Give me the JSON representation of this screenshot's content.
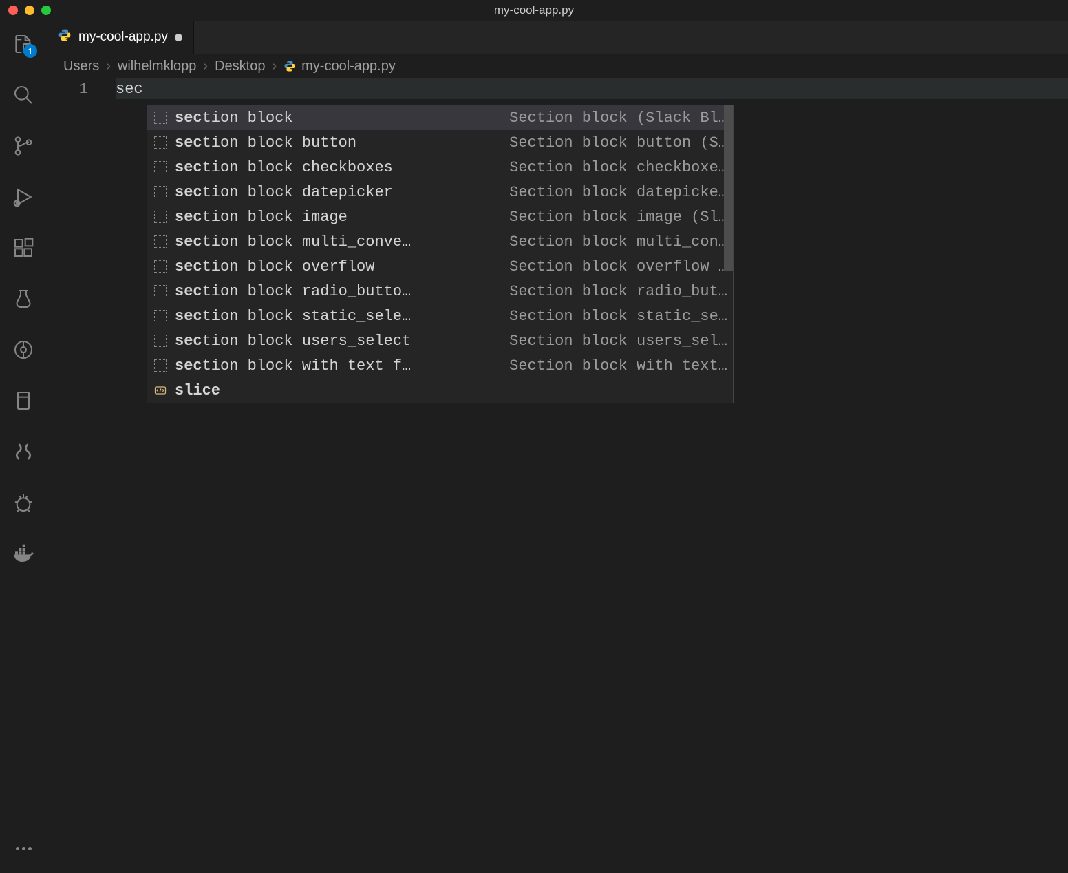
{
  "window": {
    "title": "my-cool-app.py"
  },
  "activityBar": {
    "explorer_badge": "1"
  },
  "tab": {
    "filename": "my-cool-app.py"
  },
  "breadcrumbs": {
    "segments": [
      "Users",
      "wilhelmklopp",
      "Desktop"
    ],
    "file": "my-cool-app.py"
  },
  "editor": {
    "line_number": "1",
    "typed_text": "sec"
  },
  "suggestions": [
    {
      "kind": "snippet",
      "bold": "sec",
      "rest": "tion block",
      "detail": "Section block (Slack Bl…"
    },
    {
      "kind": "snippet",
      "bold": "sec",
      "rest": "tion block button",
      "detail": "Section block button (S…"
    },
    {
      "kind": "snippet",
      "bold": "sec",
      "rest": "tion block checkboxes",
      "detail": "Section block checkboxe…"
    },
    {
      "kind": "snippet",
      "bold": "sec",
      "rest": "tion block datepicker",
      "detail": "Section block datepicke…"
    },
    {
      "kind": "snippet",
      "bold": "sec",
      "rest": "tion block image",
      "detail": "Section block image (Sl…"
    },
    {
      "kind": "snippet",
      "bold": "sec",
      "rest": "tion block multi_conve…",
      "detail": "Section block multi_con…"
    },
    {
      "kind": "snippet",
      "bold": "sec",
      "rest": "tion block overflow",
      "detail": "Section block overflow …"
    },
    {
      "kind": "snippet",
      "bold": "sec",
      "rest": "tion block radio_butto…",
      "detail": "Section block radio_but…"
    },
    {
      "kind": "snippet",
      "bold": "sec",
      "rest": "tion block static_sele…",
      "detail": "Section block static_se…"
    },
    {
      "kind": "snippet",
      "bold": "sec",
      "rest": "tion block users_select",
      "detail": "Section block users_sel…"
    },
    {
      "kind": "snippet",
      "bold": "sec",
      "rest": "tion block with text f…",
      "detail": "Section block with text…"
    },
    {
      "kind": "function",
      "bold": "sli",
      "bold2": "ce",
      "rest": "",
      "detail": ""
    }
  ]
}
